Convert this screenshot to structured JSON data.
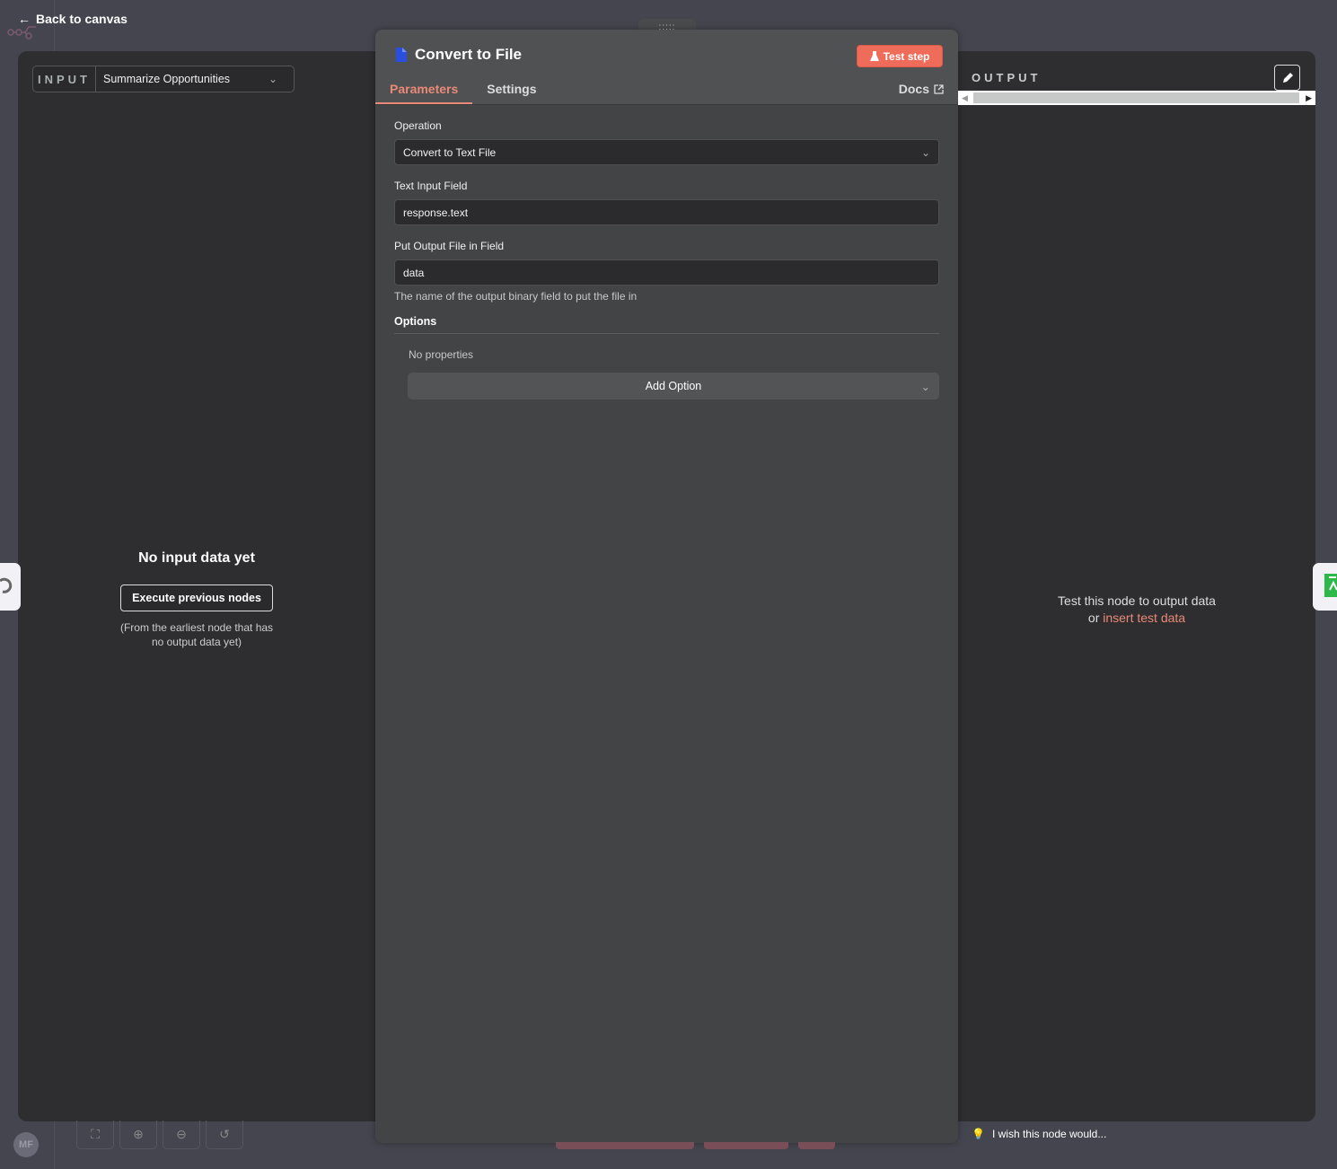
{
  "header": {
    "back_label": "Back to canvas"
  },
  "input_panel": {
    "tag": "INPUT",
    "selected_node": "Summarize Opportunities",
    "empty_title": "No input data yet",
    "execute_button": "Execute previous nodes",
    "execute_note_line1": "(From the earliest node that has",
    "execute_note_line2": "no output data yet)"
  },
  "node": {
    "title": "Convert to File",
    "icon": "file-icon",
    "accent_color": "#ef6c5a",
    "test_button": "Test step",
    "tabs": [
      {
        "label": "Parameters",
        "active": true
      },
      {
        "label": "Settings",
        "active": false
      }
    ],
    "docs_label": "Docs",
    "drag_handle": ":::::",
    "parameters": {
      "operation_label": "Operation",
      "operation_value": "Convert to Text File",
      "text_input_label": "Text Input Field",
      "text_input_value": "response.text",
      "output_field_label": "Put Output File in Field",
      "output_field_value": "data",
      "output_field_hint": "The name of the output binary field to put the file in",
      "options_label": "Options",
      "no_properties": "No properties",
      "add_option": "Add Option"
    }
  },
  "output_panel": {
    "tag": "OUTPUT",
    "message_line1": "Test this node to output data",
    "message_or": "or",
    "insert_link": "insert test data"
  },
  "footer": {
    "feedback": "I wish this node would...",
    "avatar_initials": "MF"
  }
}
